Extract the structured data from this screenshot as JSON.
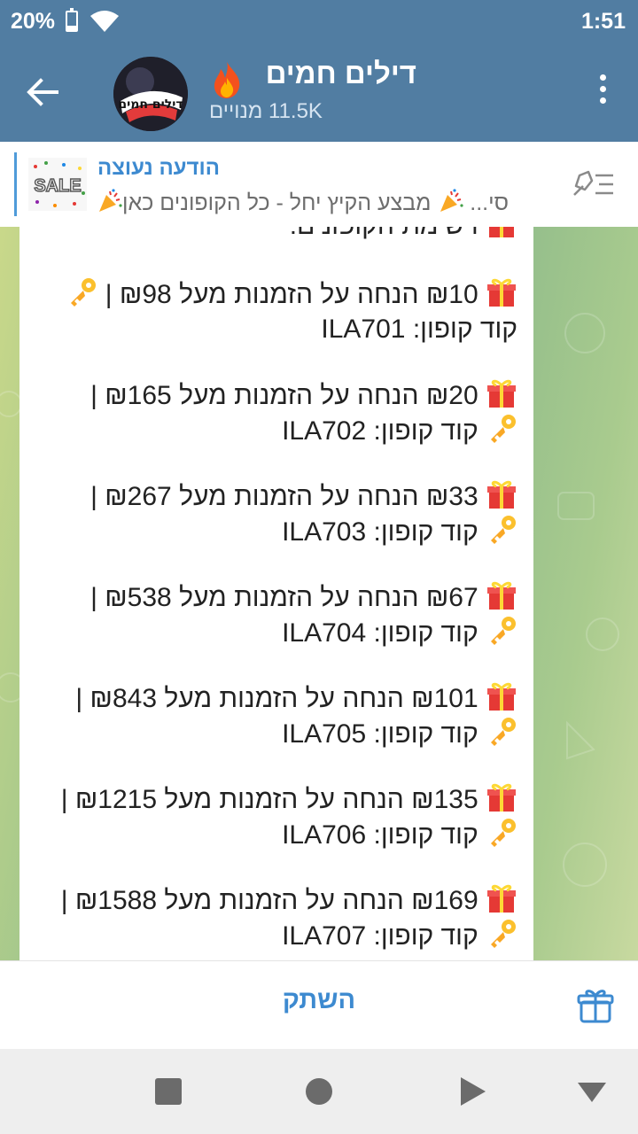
{
  "status_bar": {
    "battery": "20%",
    "time": "1:51"
  },
  "header": {
    "title": "דילים חמים",
    "subscribers": "11.5K מנויים",
    "avatar_text": "דילים חמים"
  },
  "pinned": {
    "label": "הודעה נעוצה",
    "thumb_text": "SALE",
    "text_before": "מבצע הקיץ יחל - כל הקופונים כאן",
    "text_after": "סי..."
  },
  "message": {
    "partial_line": "רשימת הקופונים:",
    "coupons": [
      {
        "line1": "₪10 הנחה על הזמנות מעל ₪98 |",
        "code_label": "קוד קופון:",
        "code": "ILA701"
      },
      {
        "line1": "₪20 הנחה על הזמנות מעל ₪165 |",
        "code_label": "קוד קופון:",
        "code": "ILA702"
      },
      {
        "line1": "₪33 הנחה על הזמנות מעל ₪267 |",
        "code_label": "קוד קופון:",
        "code": "ILA703"
      },
      {
        "line1": "₪67 הנחה על הזמנות מעל ₪538 |",
        "code_label": "קוד קופון:",
        "code": "ILA704"
      },
      {
        "line1": "₪101 הנחה על הזמנות מעל ₪843 |",
        "code_label": "קוד קופון:",
        "code": "ILA705"
      },
      {
        "line1": "₪135 הנחה על הזמנות מעל ₪1215 |",
        "code_label": "קוד קופון:",
        "code": "ILA706"
      },
      {
        "line1": "₪169 הנחה על הזמנות מעל ₪1588 |",
        "code_label": "קוד קופון:",
        "code": "ILA707"
      }
    ]
  },
  "action_bar": {
    "mute_label": "השתק"
  },
  "icons": {
    "back": "arrow-left-icon",
    "menu": "more-vertical-icon",
    "gift": "gift-icon",
    "key": "key-icon",
    "party": "party-popper-icon",
    "fire": "fire-icon",
    "unpin": "unpin-icon"
  },
  "colors": {
    "header": "#517da2",
    "accent": "#3d8ad0"
  }
}
